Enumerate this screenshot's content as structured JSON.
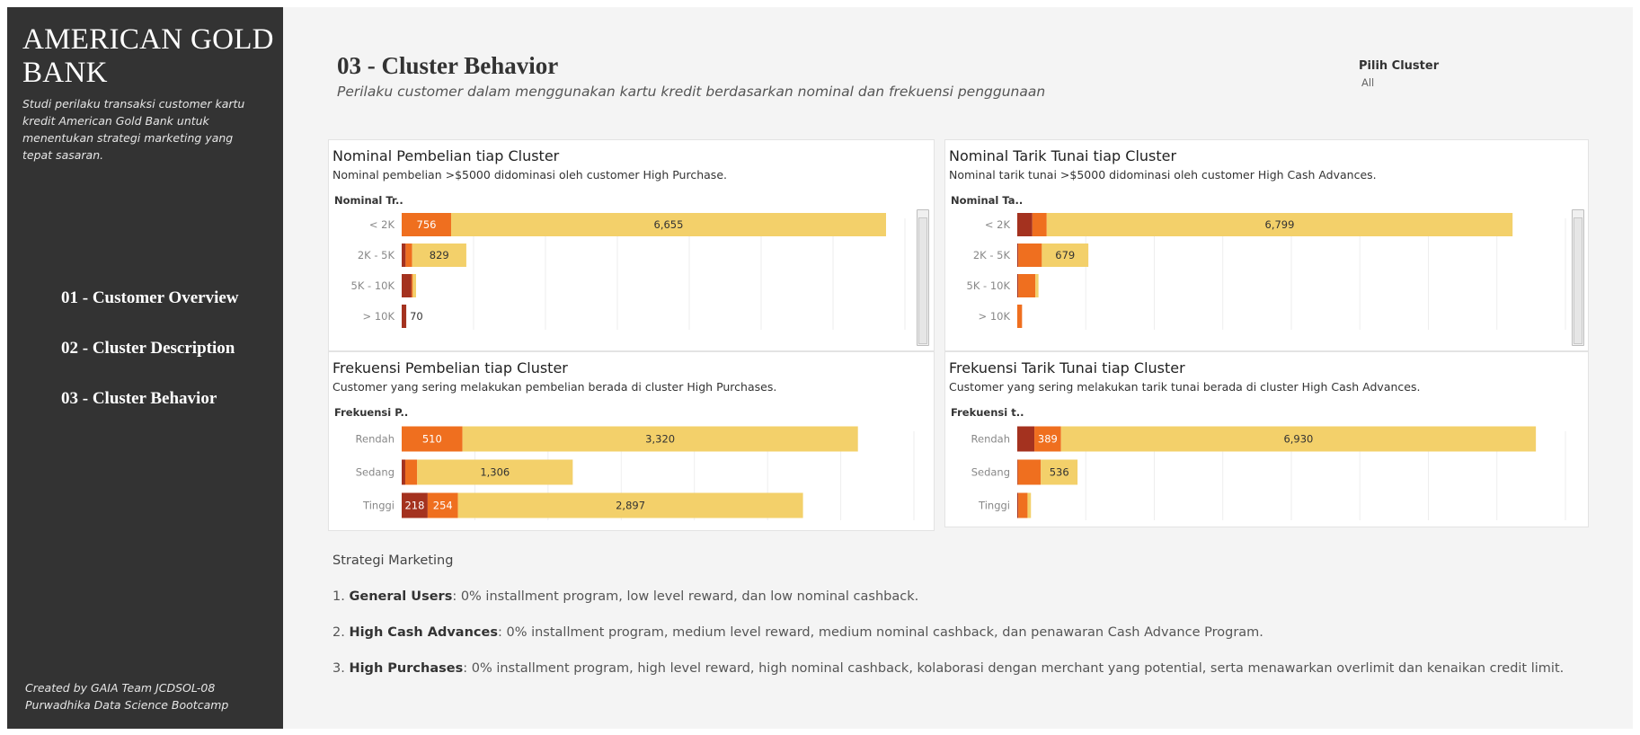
{
  "sidebar": {
    "brand": "AMERICAN GOLD BANK",
    "description": "Studi perilaku transaksi customer kartu kredit American Gold Bank untuk menentukan strategi marketing yang tepat sasaran.",
    "nav": [
      "01 - Customer Overview",
      "02 - Cluster Description",
      "03 - Cluster Behavior"
    ],
    "credit_line1": "Created by GAIA Team JCDSOL-08",
    "credit_line2": "Purwadhika Data Science Bootcamp"
  },
  "header": {
    "title": "03 - Cluster Behavior",
    "subtitle": "Perilaku  customer dalam menggunakan kartu kredit berdasarkan nominal dan frekuensi penggunaan"
  },
  "filter": {
    "label": "Pilih Cluster",
    "value": "All"
  },
  "colors": {
    "general": "#a4321f",
    "cash": "#ef6f1f",
    "purchases": "#f3d06a"
  },
  "panels": {
    "p1": {
      "title": "Nominal Pembelian tiap Cluster",
      "subtitle": "Nominal pembelian >$5000 didominasi oleh customer High Purchase.",
      "field": "Nominal Tr.."
    },
    "p2": {
      "title": "Nominal Tarik Tunai tiap Cluster",
      "subtitle": "Nominal tarik tunai >$5000 didominasi oleh customer High Cash Advances.",
      "field": "Nominal Ta.."
    },
    "p3": {
      "title": "Frekuensi Pembelian tiap Cluster",
      "subtitle": "Customer yang sering melakukan pembelian berada di cluster High Purchases.",
      "field": "Frekuensi P.."
    },
    "p4": {
      "title": "Frekuensi Tarik Tunai tiap Cluster",
      "subtitle": "Customer yang sering melakukan tarik tunai berada di cluster High Cash Advances.",
      "field": "Frekuensi t.."
    }
  },
  "chart_data": [
    {
      "type": "bar",
      "orientation": "horizontal",
      "stacked": true,
      "title": "Nominal Pembelian tiap Cluster",
      "categories": [
        "< 2K",
        "2K - 5K",
        "5K - 10K",
        "> 10K"
      ],
      "series": [
        {
          "name": "General Users",
          "values": [
            0,
            60,
            150,
            70
          ]
        },
        {
          "name": "High Cash Advances",
          "values": [
            756,
            100,
            20,
            0
          ]
        },
        {
          "name": "High Purchases",
          "values": [
            6655,
            829,
            50,
            0
          ]
        }
      ],
      "labels": [
        [
          "",
          "756",
          "6,655"
        ],
        [
          "",
          "",
          "829"
        ],
        [
          "",
          "",
          ""
        ],
        [
          "70",
          "",
          ""
        ]
      ],
      "xlim": [
        0,
        7700
      ]
    },
    {
      "type": "bar",
      "orientation": "horizontal",
      "stacked": true,
      "title": "Nominal Tarik Tunai tiap Cluster",
      "categories": [
        "< 2K",
        "2K - 5K",
        "5K - 10K",
        "> 10K"
      ],
      "series": [
        {
          "name": "General Users",
          "values": [
            220,
            15,
            15,
            0
          ]
        },
        {
          "name": "High Cash Advances",
          "values": [
            210,
            344,
            250,
            70
          ]
        },
        {
          "name": "High Purchases",
          "values": [
            6799,
            679,
            45,
            0
          ]
        }
      ],
      "labels": [
        [
          "",
          "",
          "6,799"
        ],
        [
          "",
          "344",
          "679"
        ],
        [
          "",
          "",
          ""
        ],
        [
          "",
          "",
          ""
        ]
      ],
      "xlim": [
        0,
        8000
      ]
    },
    {
      "type": "bar",
      "orientation": "horizontal",
      "stacked": true,
      "title": "Frekuensi Pembelian tiap Cluster",
      "categories": [
        "Rendah",
        "Sedang",
        "Tinggi"
      ],
      "series": [
        {
          "name": "General Users",
          "values": [
            0,
            30,
            218
          ]
        },
        {
          "name": "High Cash Advances",
          "values": [
            510,
            100,
            254
          ]
        },
        {
          "name": "High Purchases",
          "values": [
            3320,
            1306,
            2897
          ]
        }
      ],
      "labels": [
        [
          "",
          "510",
          "3,320"
        ],
        [
          "",
          "",
          "1,306"
        ],
        [
          "218",
          "254",
          "2,897"
        ]
      ],
      "xlim": [
        0,
        4300
      ]
    },
    {
      "type": "bar",
      "orientation": "horizontal",
      "stacked": true,
      "title": "Frekuensi Tarik Tunai tiap Cluster",
      "categories": [
        "Rendah",
        "Sedang",
        "Tinggi"
      ],
      "series": [
        {
          "name": "General Users",
          "values": [
            250,
            10,
            15
          ]
        },
        {
          "name": "High Cash Advances",
          "values": [
            389,
            334,
            135
          ]
        },
        {
          "name": "High Purchases",
          "values": [
            6930,
            536,
            50
          ]
        }
      ],
      "labels": [
        [
          "",
          "389",
          "6,930"
        ],
        [
          "",
          "334",
          "536"
        ],
        [
          "",
          "",
          ""
        ]
      ],
      "xlim": [
        0,
        8000
      ]
    }
  ],
  "strategy": {
    "title": "Strategi Marketing",
    "items": [
      {
        "num": "1.",
        "bold": "General Users",
        "text": ": 0% installment program, low level reward, dan low nominal cashback."
      },
      {
        "num": "2.",
        "bold": "High Cash Advances",
        "text": ": 0% installment program, medium level reward, medium nominal cashback, dan penawaran Cash Advance Program."
      },
      {
        "num": "3.",
        "bold": "High Purchases",
        "text": ": 0% installment program, high level reward, high nominal cashback, kolaborasi dengan merchant yang potential, serta menawarkan overlimit dan kenaikan credit limit."
      }
    ]
  }
}
